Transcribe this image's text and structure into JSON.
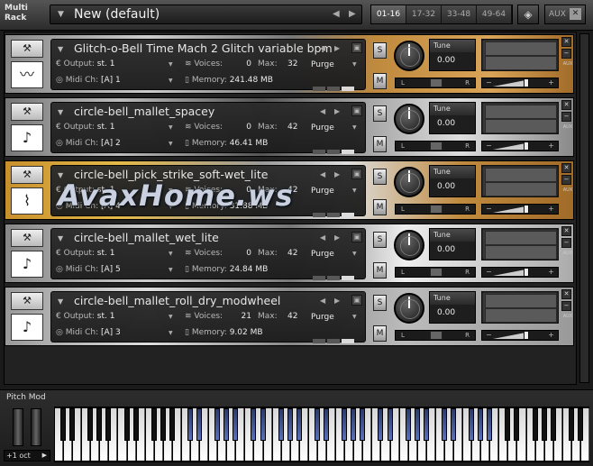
{
  "header": {
    "title": "Multi Rack",
    "preset_name": "New (default)",
    "page_tabs": [
      "01-16",
      "17-32",
      "33-48",
      "49-64"
    ],
    "active_tab": "01-16",
    "aux_label": "AUX"
  },
  "labels": {
    "output": "Output:",
    "midi": "Midi Ch:",
    "voices": "Voices:",
    "max": "Max:",
    "memory": "Memory:",
    "purge": "Purge",
    "tune": "Tune",
    "solo": "S",
    "mute": "M",
    "pan_l": "L",
    "pan_r": "R",
    "aux_small": "AUX"
  },
  "instruments": [
    {
      "name": "Glitch-o-Bell Time Mach 2 Glitch variable bpm",
      "output": "st. 1",
      "midi": "[A]  1",
      "voices": "0",
      "max": "32",
      "memory": "241.48 MB",
      "tune": "0.00",
      "icon": "waveform-icon"
    },
    {
      "name": "circle-bell_mallet_spacey",
      "output": "st. 1",
      "midi": "[A]  2",
      "voices": "0",
      "max": "42",
      "memory": "46.41 MB",
      "tune": "0.00",
      "icon": "mallet-icon"
    },
    {
      "name": "circle-bell_pick_strike_soft-wet_lite",
      "output": "st. 1",
      "midi": "[A]  4",
      "voices": "0",
      "max": "42",
      "memory": "31.88 MB",
      "tune": "0.00",
      "icon": "pick-icon"
    },
    {
      "name": "circle-bell_mallet_wet_lite",
      "output": "st. 1",
      "midi": "[A]  5",
      "voices": "0",
      "max": "42",
      "memory": "24.84 MB",
      "tune": "0.00",
      "icon": "mallet-icon"
    },
    {
      "name": "circle-bell_mallet_roll_dry_modwheel",
      "output": "st. 1",
      "midi": "[A]  3",
      "voices": "21",
      "max": "42",
      "memory": "9.02 MB",
      "tune": "0.00",
      "icon": "mallet-icon"
    }
  ],
  "footer": {
    "pitch_mod_label": "Pitch Mod",
    "octave": "+1 oct"
  },
  "watermark": "AvaxHome.ws",
  "colors": {
    "panel_bg": "#222222",
    "wood": "#b07a2e",
    "accent_blue": "#4a60a8"
  }
}
